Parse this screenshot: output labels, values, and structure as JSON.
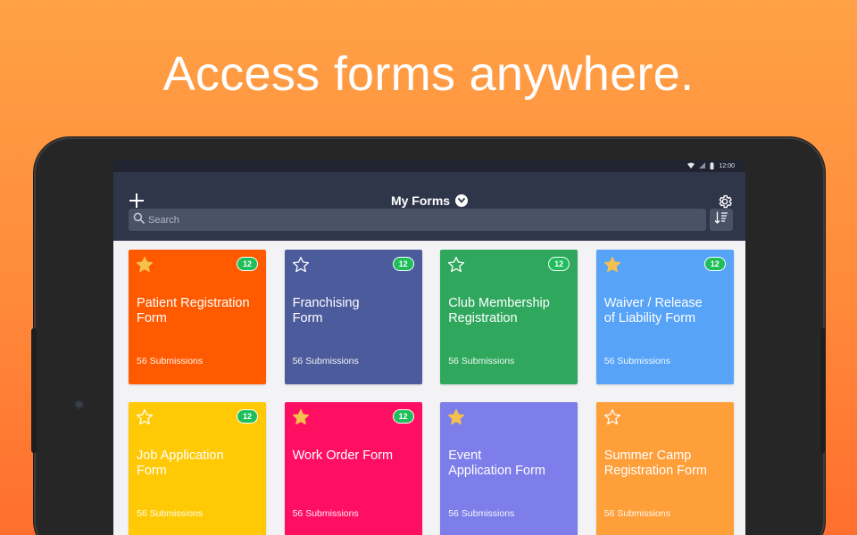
{
  "headline": "Access forms anywhere.",
  "statusbar": {
    "time": "12:00"
  },
  "header": {
    "title": "My Forms",
    "search_placeholder": "Search"
  },
  "colors": {
    "accent_badge": "#1fbe5a",
    "appbar": "#2f3649",
    "star_filled": "#f5c04d"
  },
  "forms": [
    {
      "title_line1": "Patient Registration",
      "title_line2": "Form",
      "submissions": "56 Submissions",
      "badge": "12",
      "starred": true,
      "color": "#ff5a00"
    },
    {
      "title_line1": "Franchising",
      "title_line2": "Form",
      "submissions": "56 Submissions",
      "badge": "12",
      "starred": false,
      "color": "#4c5b9c"
    },
    {
      "title_line1": "Club Membership",
      "title_line2": "Registration",
      "submissions": "56 Submissions",
      "badge": "12",
      "starred": false,
      "color": "#2fa85e"
    },
    {
      "title_line1": "Waiver / Release",
      "title_line2": "of Liability Form",
      "submissions": "56 Submissions",
      "badge": "12",
      "starred": true,
      "color": "#56a3f8"
    },
    {
      "title_line1": "Job Application",
      "title_line2": "Form",
      "submissions": "56 Submissions",
      "badge": "12",
      "starred": false,
      "color": "#ffca05"
    },
    {
      "title_line1": "Work Order Form",
      "title_line2": "",
      "submissions": "56 Submissions",
      "badge": "12",
      "starred": true,
      "color": "#ff0f62"
    },
    {
      "title_line1": "Event",
      "title_line2": "Application Form",
      "submissions": "56 Submissions",
      "badge": "",
      "starred": true,
      "color": "#7d7ee9"
    },
    {
      "title_line1": "Summer Camp",
      "title_line2": "Registration Form",
      "submissions": "56 Submissions",
      "badge": "",
      "starred": false,
      "color": "#ff9f3a"
    }
  ]
}
